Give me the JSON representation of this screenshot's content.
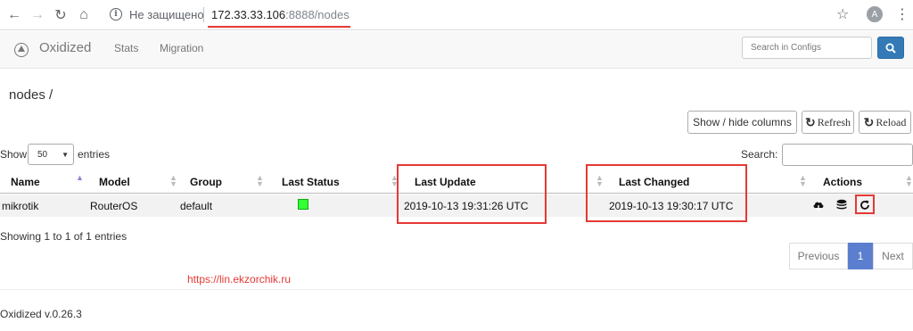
{
  "browser": {
    "insecure_label": "Не защищено",
    "url_host": "172.33.33.106",
    "url_rest": ":8888/nodes",
    "profile_initial": "A"
  },
  "navbar": {
    "brand": "Oxidized",
    "links": [
      "Stats",
      "Migration"
    ],
    "search_placeholder": "Search in Configs"
  },
  "page": {
    "title": "nodes /"
  },
  "toolbar": {
    "show_hide_label": "Show / hide columns",
    "refresh_label": "Refresh",
    "reload_label": "Reload"
  },
  "table_controls": {
    "show_label": "Show",
    "length_value": "50",
    "entries_label": "entries",
    "search_label": "Search:"
  },
  "table": {
    "columns": [
      "Name",
      "Model",
      "Group",
      "Last Status",
      "Last Update",
      "Last Changed",
      "Actions"
    ],
    "rows": [
      {
        "name": "mikrotik",
        "model": "RouterOS",
        "group": "default",
        "last_status_color": "#33ff33",
        "last_update": "2019-10-13 19:31:26 UTC",
        "last_changed": "2019-10-13 19:30:17 UTC"
      }
    ],
    "action_icons": [
      "cloud-download-icon",
      "database-icon",
      "refresh-icon"
    ]
  },
  "info": "Showing 1 to 1 of 1 entries",
  "pagination": {
    "previous": "Previous",
    "current": "1",
    "next": "Next"
  },
  "watermark": "https://lin.ekzorchik.ru",
  "footer": "Oxidized v.0.26.3",
  "colors": {
    "primary": "#337ab7",
    "highlight": "#e53935",
    "status_ok": "#33ff33"
  }
}
